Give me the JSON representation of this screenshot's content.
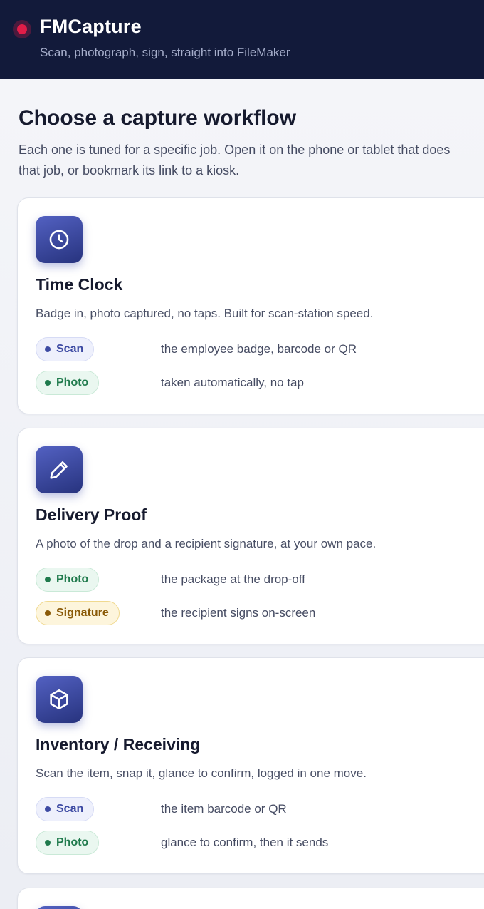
{
  "app": {
    "title": "FMCapture",
    "subtitle": "Scan, photograph, sign, straight into FileMaker"
  },
  "page": {
    "heading": "Choose a capture workflow",
    "intro": "Each one is tuned for a specific job. Open it on the phone or tablet that does that job, or bookmark its link to a kiosk."
  },
  "workflows": [
    {
      "icon": "clock-icon",
      "title": "Time Clock",
      "description": "Badge in, photo captured, no taps. Built for scan-station speed.",
      "steps": [
        {
          "tag": "Scan",
          "kind": "scan",
          "text": "the employee badge, barcode or QR"
        },
        {
          "tag": "Photo",
          "kind": "photo",
          "text": "taken automatically, no tap"
        }
      ]
    },
    {
      "icon": "pencil-icon",
      "title": "Delivery Proof",
      "description": "A photo of the drop and a recipient signature, at your own pace.",
      "steps": [
        {
          "tag": "Photo",
          "kind": "photo",
          "text": "the package at the drop-off"
        },
        {
          "tag": "Signature",
          "kind": "signature",
          "text": "the recipient signs on-screen"
        }
      ]
    },
    {
      "icon": "box-icon",
      "title": "Inventory / Receiving",
      "description": "Scan the item, snap it, glance to confirm, logged in one move.",
      "steps": [
        {
          "tag": "Scan",
          "kind": "scan",
          "text": "the item barcode or QR"
        },
        {
          "tag": "Photo",
          "kind": "photo",
          "text": "glance to confirm, then it sends"
        }
      ]
    }
  ],
  "colors": {
    "header_bg": "#121a3a",
    "record_dot": "#e11d48",
    "icon_tile": "#3b47a0",
    "scan": "#3d4aa3",
    "photo": "#1f7a4c",
    "signature": "#8a5a07"
  }
}
